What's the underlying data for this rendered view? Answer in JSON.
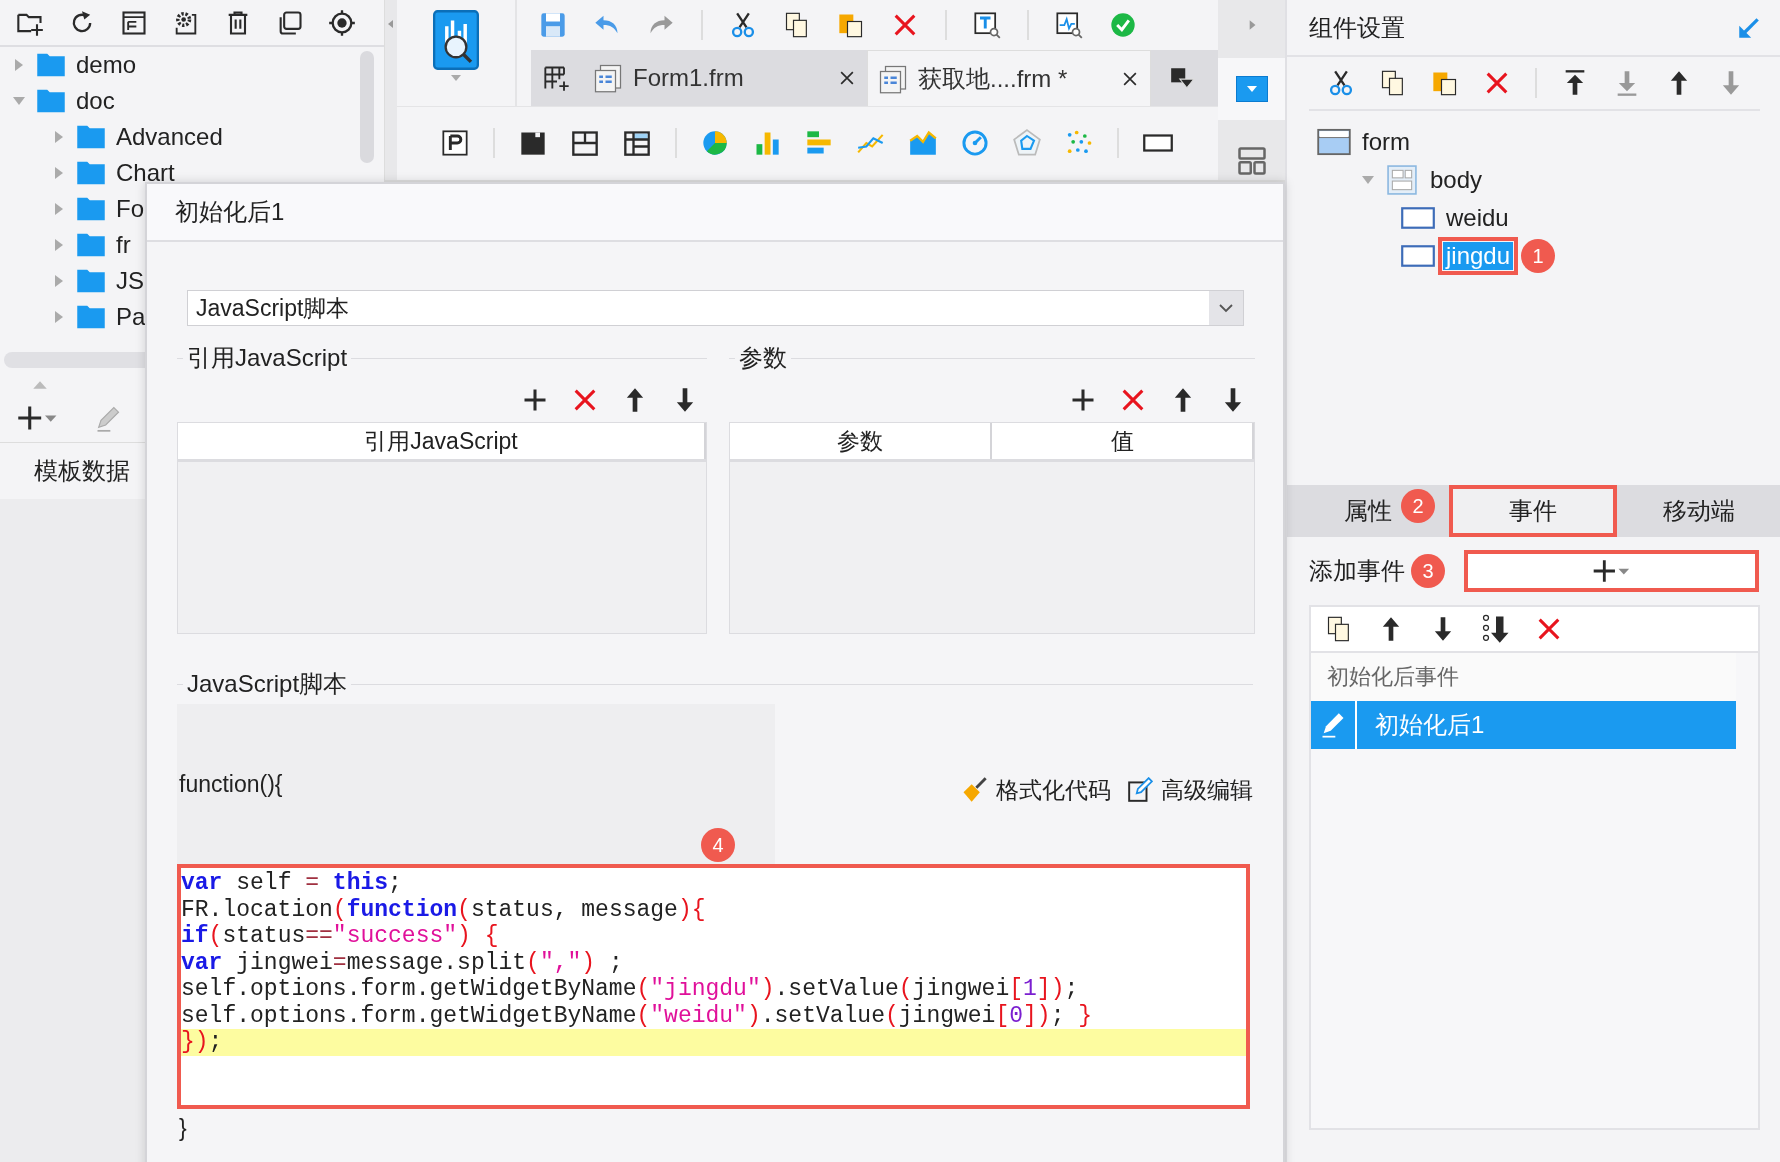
{
  "left_panel": {
    "tree": [
      {
        "label": "demo",
        "expanded": false
      },
      {
        "label": "doc",
        "expanded": true,
        "children": [
          {
            "label": "Advanced",
            "expanded": false
          },
          {
            "label": "Chart",
            "expanded": false
          },
          {
            "label": "Fo",
            "expanded": false
          },
          {
            "label": "fr",
            "expanded": false
          },
          {
            "label": "JS",
            "expanded": false
          },
          {
            "label": "Pa",
            "expanded": false
          }
        ]
      }
    ],
    "dataset_tab": "模板数据"
  },
  "editor_tabs": [
    {
      "label": "Form1.frm",
      "selected": false
    },
    {
      "label": "获取地....frm *",
      "selected": true
    }
  ],
  "dialog": {
    "title": "初始化后1",
    "type_select": {
      "value": "JavaScript脚本"
    },
    "imports": {
      "title": "引用JavaScript",
      "columns": [
        "引用JavaScript"
      ]
    },
    "params": {
      "title": "参数",
      "columns": [
        "参数",
        "值"
      ]
    },
    "script": {
      "title": "JavaScript脚本",
      "header": "function(){",
      "actions": [
        "格式化代码",
        "高级编辑"
      ],
      "annotation": "4",
      "lines": [
        {
          "current": false,
          "tokens": [
            {
              "kind": "keyword",
              "t": "var"
            },
            {
              "kind": "plain",
              "t": " self "
            },
            {
              "kind": "operator",
              "t": "="
            },
            {
              "kind": "keyword",
              "t": " this"
            },
            {
              "kind": "plain",
              "t": ";"
            }
          ]
        },
        {
          "current": false,
          "tokens": [
            {
              "kind": "plain",
              "t": "FR.location"
            },
            {
              "kind": "paren",
              "t": "("
            },
            {
              "kind": "keyword",
              "t": "function"
            },
            {
              "kind": "paren",
              "t": "("
            },
            {
              "kind": "plain",
              "t": "status, message"
            },
            {
              "kind": "paren",
              "t": "){"
            }
          ]
        },
        {
          "current": false,
          "tokens": [
            {
              "kind": "keyword",
              "t": "if"
            },
            {
              "kind": "paren",
              "t": "("
            },
            {
              "kind": "plain",
              "t": "status"
            },
            {
              "kind": "operator",
              "t": "=="
            },
            {
              "kind": "string",
              "t": "\"success\""
            },
            {
              "kind": "paren",
              "t": ") {"
            }
          ]
        },
        {
          "current": false,
          "tokens": [
            {
              "kind": "keyword",
              "t": "var"
            },
            {
              "kind": "plain",
              "t": " jingwei"
            },
            {
              "kind": "operator",
              "t": "="
            },
            {
              "kind": "plain",
              "t": "message.split"
            },
            {
              "kind": "paren",
              "t": "("
            },
            {
              "kind": "string",
              "t": "\",\""
            },
            {
              "kind": "paren",
              "t": ")"
            },
            {
              "kind": "plain",
              "t": " ;"
            }
          ]
        },
        {
          "current": false,
          "tokens": [
            {
              "kind": "plain",
              "t": "self.options.form.getWidgetByName"
            },
            {
              "kind": "paren",
              "t": "("
            },
            {
              "kind": "string",
              "t": "\"jingdu\""
            },
            {
              "kind": "paren",
              "t": ")"
            },
            {
              "kind": "plain",
              "t": ".setValue"
            },
            {
              "kind": "paren",
              "t": "("
            },
            {
              "kind": "plain",
              "t": "jingwei"
            },
            {
              "kind": "paren",
              "t": "["
            },
            {
              "kind": "number",
              "t": "1"
            },
            {
              "kind": "paren",
              "t": "])"
            },
            {
              "kind": "plain",
              "t": ";"
            }
          ]
        },
        {
          "current": false,
          "tokens": [
            {
              "kind": "plain",
              "t": "self.options.form.getWidgetByName"
            },
            {
              "kind": "paren",
              "t": "("
            },
            {
              "kind": "string",
              "t": "\"weidu\""
            },
            {
              "kind": "paren",
              "t": ")"
            },
            {
              "kind": "plain",
              "t": ".setValue"
            },
            {
              "kind": "paren",
              "t": "("
            },
            {
              "kind": "plain",
              "t": "jingwei"
            },
            {
              "kind": "paren",
              "t": "["
            },
            {
              "kind": "number",
              "t": "0"
            },
            {
              "kind": "paren",
              "t": "])"
            },
            {
              "kind": "plain",
              "t": "; "
            },
            {
              "kind": "paren",
              "t": "}"
            }
          ]
        },
        {
          "current": true,
          "tokens": [
            {
              "kind": "paren",
              "t": "})"
            },
            {
              "kind": "plain",
              "t": ";"
            }
          ]
        }
      ],
      "footer": "}"
    }
  },
  "component_settings": {
    "title": "组件设置",
    "tree": [
      {
        "label": "form",
        "kind": "form",
        "selected": false,
        "children": [
          {
            "label": "body",
            "kind": "layout",
            "selected": false,
            "expanded": true,
            "children": [
              {
                "label": "weidu",
                "kind": "widget",
                "selected": false
              },
              {
                "label": "jingdu",
                "kind": "widget",
                "selected": true,
                "annotation": "1"
              }
            ]
          }
        ]
      }
    ],
    "tabs": [
      {
        "label": "属性",
        "selected": false
      },
      {
        "label": "事件",
        "selected": true,
        "annotation": "2"
      },
      {
        "label": "移动端",
        "selected": false
      }
    ],
    "add_event": {
      "label": "添加事件",
      "annotation": "3"
    },
    "events": {
      "group": "初始化后事件",
      "items": [
        {
          "label": "初始化后1",
          "selected": true
        }
      ]
    }
  }
}
